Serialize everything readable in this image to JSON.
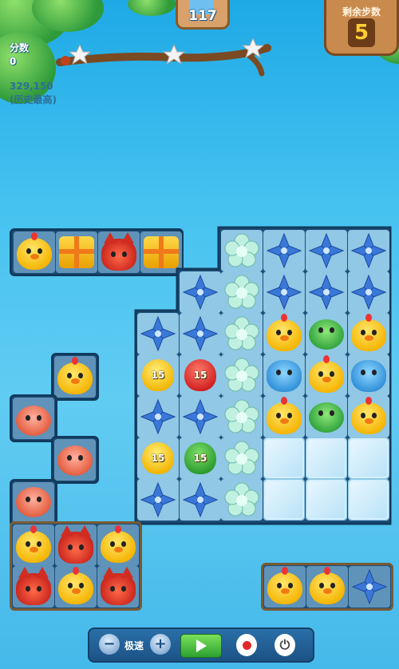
{
  "hud": {
    "level": "117",
    "moves_label": "剩余步数",
    "moves_remaining": "5",
    "score_label": "分数",
    "score": "0",
    "best_score": "329,150",
    "best_label": "(历史最高)"
  },
  "balloons": {
    "b1": "15",
    "b2": "15",
    "b3": "15",
    "b4": "15"
  },
  "controls": {
    "speed_label": "极速",
    "minus": "−",
    "plus": "+",
    "power": "⏻"
  },
  "colors": {
    "sky": "#45c2f0",
    "board": "#1d4f7a",
    "moves_text": "#ffcf33",
    "play_button": "#2ca12f"
  }
}
